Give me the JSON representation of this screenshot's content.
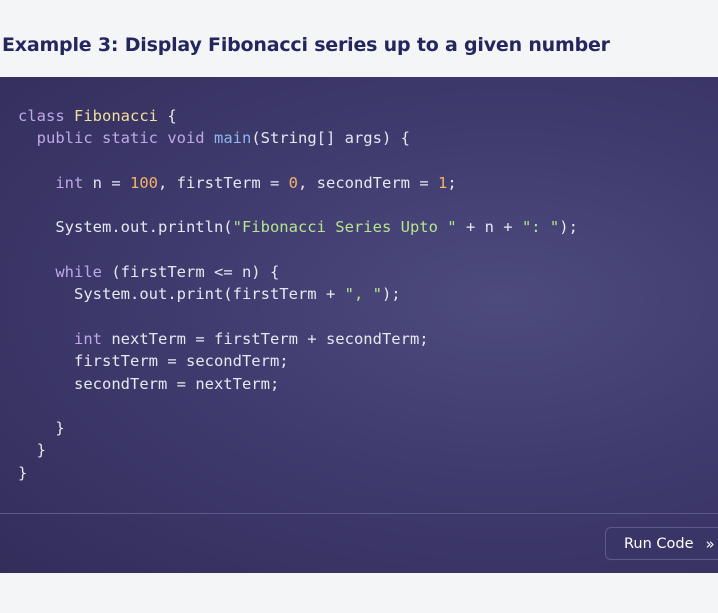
{
  "page": {
    "heading": "Example 3: Display Fibonacci series up to a given number"
  },
  "code": {
    "line1": {
      "kw": "class",
      "name": "Fibonacci",
      "rest": " {"
    },
    "line2": {
      "kw": "public static void",
      "fn": "main",
      "rest": "(String[] args) {"
    },
    "line3": {
      "kw": "int",
      "a": " n = ",
      "n1": "100",
      "b": ", firstTerm = ",
      "n2": "0",
      "c": ", secondTerm = ",
      "n3": "1",
      "d": ";"
    },
    "line4": {
      "a": "System.out.println(",
      "str1": "\"Fibonacci Series Upto \"",
      "b": " + n + ",
      "str2": "\": \"",
      "c": ");"
    },
    "line5": {
      "kw": "while",
      "rest": " (firstTerm <= n) {"
    },
    "line6": {
      "a": "System.out.print(firstTerm + ",
      "str": "\", \"",
      "b": ");"
    },
    "line7": {
      "kw": "int",
      "rest": " nextTerm = firstTerm + secondTerm;"
    },
    "line8": "firstTerm = secondTerm;",
    "line9": "secondTerm = nextTerm;",
    "close1": "}",
    "close2": "}",
    "close3": "}"
  },
  "run_button": {
    "label": "Run Code",
    "icon": "double-chevron-right-icon",
    "icon_glyph": "»"
  },
  "colors": {
    "heading": "#25265e",
    "panel": "#3f3b6e",
    "keyword": "#bea9e6",
    "function": "#8fb7f0",
    "class_name": "#f3dfa0",
    "number": "#f2b36a",
    "string": "#b7e48d"
  }
}
